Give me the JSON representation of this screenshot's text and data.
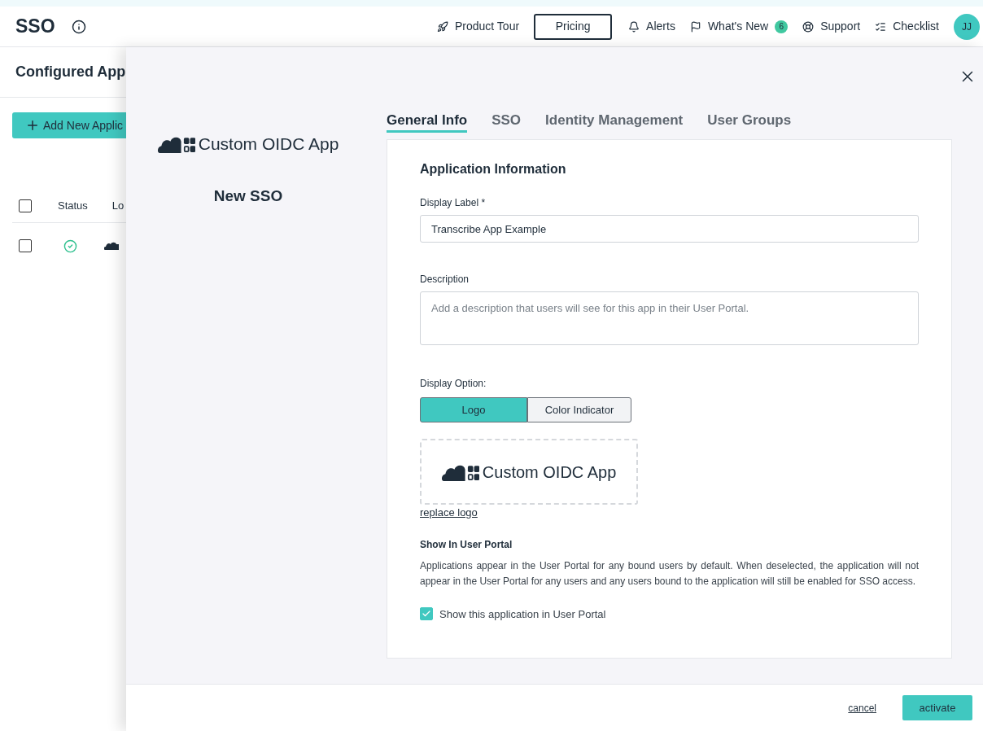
{
  "header": {
    "title": "SSO",
    "nav": [
      {
        "label": "Product Tour",
        "kind": "link"
      },
      {
        "label": "Pricing",
        "kind": "button"
      },
      {
        "label": "Alerts",
        "kind": "link"
      },
      {
        "label": "What's New",
        "kind": "link",
        "badge": "6"
      },
      {
        "label": "Support",
        "kind": "link"
      },
      {
        "label": "Checklist",
        "kind": "link"
      }
    ],
    "avatar": "JJ"
  },
  "background": {
    "title": "Configured App",
    "add_button": "Add New Applic",
    "columns": [
      "Status",
      "Lo"
    ],
    "header_checked": false,
    "rows": [
      {
        "checked": false
      }
    ]
  },
  "panel": {
    "logo_text": "Custom OIDC App",
    "subtitle": "New SSO",
    "tabs": [
      {
        "label": "General Info",
        "selected": true
      },
      {
        "label": "SSO",
        "selected": false
      },
      {
        "label": "Identity Management",
        "selected": false
      },
      {
        "label": "User Groups",
        "selected": false
      }
    ],
    "section_title": "Application Information",
    "fields": [
      {
        "label": "Display Label *",
        "value": "Transcribe App Example",
        "kind": "input"
      },
      {
        "label": "Description",
        "placeholder": "Add a description that users will see for this app in their User Portal.",
        "kind": "textarea"
      }
    ],
    "display_option": {
      "label": "Display Option:",
      "options": [
        {
          "label": "Logo",
          "selected": true
        },
        {
          "label": "Color Indicator",
          "selected": false
        }
      ]
    },
    "logo_preview": {
      "text": "Custom OIDC App",
      "link": "replace logo"
    },
    "portal": {
      "title": "Show In User Portal",
      "text": "Applications appear in the User Portal for any bound users by default. When deselected, the application will not appear in the User Portal for any users and any users bound to the application will still be enabled for SSO access.",
      "checkbox": {
        "label": "Show this application in User Portal",
        "checked": true
      }
    }
  },
  "footer": {
    "cancel": "cancel",
    "activate": "activate"
  }
}
